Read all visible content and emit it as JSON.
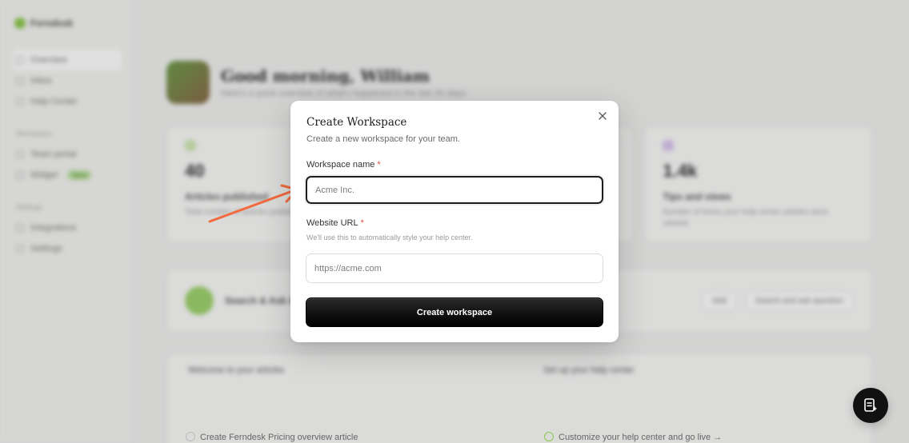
{
  "background": {
    "brand": "Ferndesk",
    "nav": [
      "Overview",
      "Inbox",
      "Help Center"
    ],
    "nav_sections": [
      "Workspace",
      "Settings"
    ],
    "nav_more": [
      "Team portal",
      "Widget",
      "Integrations",
      "Settings"
    ],
    "nav_badge": "New",
    "greeting_title": "Good morning, William",
    "greeting_sub": "Here's a quick overview of what's happened in the last 30 days.",
    "stats": [
      {
        "number": "40",
        "label": "Articles published",
        "desc": "Total number of articles published in your help center."
      },
      {
        "number": "",
        "label": "",
        "desc": ""
      },
      {
        "number": "1.4k",
        "label": "Tips and views",
        "desc": "Number of times your help center articles were viewed."
      }
    ],
    "banner_text": "Search & Ask AI",
    "banner_btn1": "Add",
    "banner_btn2": "Search and ask question",
    "tasks_left_title": "Welcome to your articles",
    "tasks_right_title": "Set up your help center",
    "task_left_item": "Create Ferndesk Pricing overview article",
    "task_right_item": "Customize your help center and go live →"
  },
  "modal": {
    "title": "Create Workspace",
    "subtitle": "Create a new workspace for your team.",
    "workspace_label": "Workspace name",
    "workspace_placeholder": "Acme Inc.",
    "workspace_value": "",
    "url_label": "Website URL",
    "url_help": "We'll use this to automatically style your help center.",
    "url_placeholder": "https://acme.com",
    "url_value": "",
    "required_mark": "*",
    "submit_label": "Create workspace",
    "close_icon": "close-icon"
  },
  "colors": {
    "accent": "#000000",
    "required": "#e04a3a",
    "arrow": "#f26a3d"
  }
}
